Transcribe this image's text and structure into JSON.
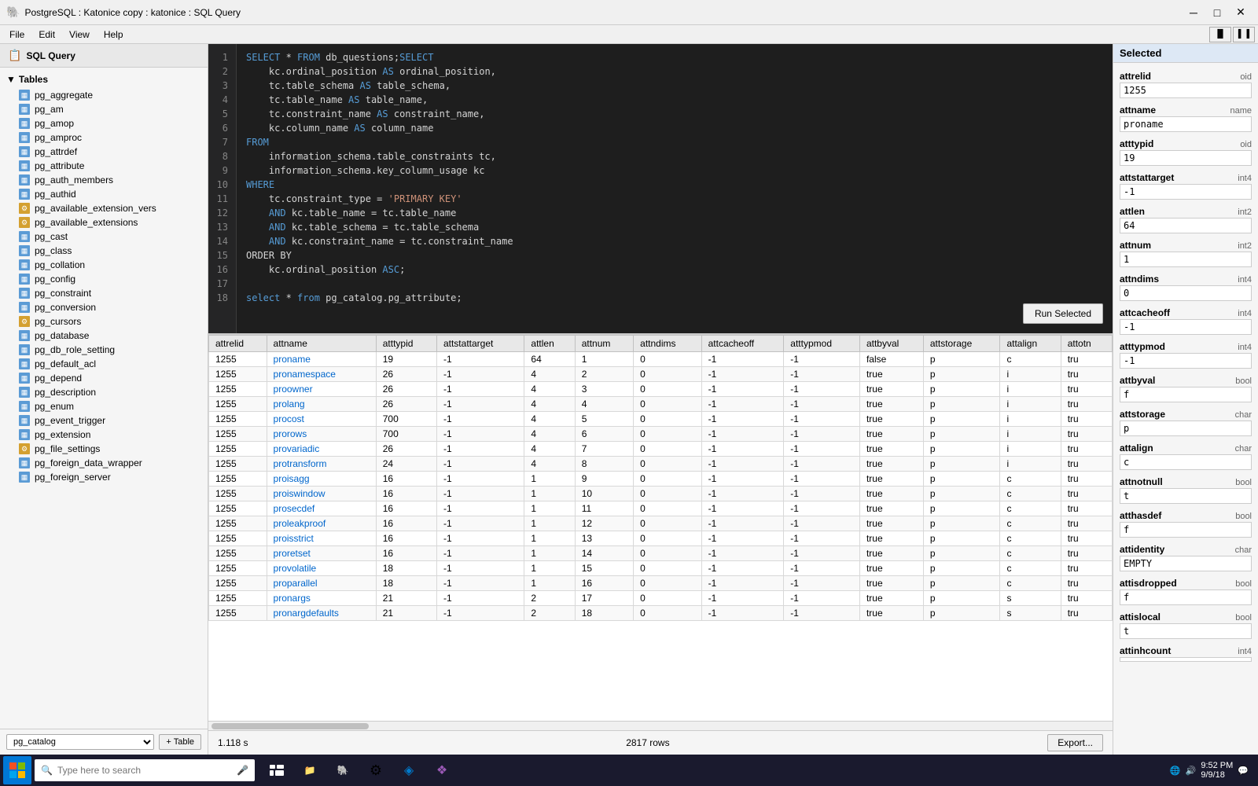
{
  "titleBar": {
    "icon": "🐘",
    "title": "PostgreSQL : Katonice copy : katonice : SQL Query",
    "minimize": "─",
    "maximize": "□",
    "close": "✕"
  },
  "menuBar": {
    "items": [
      "File",
      "Edit",
      "View",
      "Help"
    ]
  },
  "sidebar": {
    "header": "SQL Query",
    "section": "Tables",
    "tables": [
      "pg_aggregate",
      "pg_am",
      "pg_amop",
      "pg_amproc",
      "pg_attrdef",
      "pg_attribute",
      "pg_auth_members",
      "pg_authid",
      "pg_available_extension_vers",
      "pg_available_extensions",
      "pg_cast",
      "pg_class",
      "pg_collation",
      "pg_config",
      "pg_constraint",
      "pg_conversion",
      "pg_cursors",
      "pg_database",
      "pg_db_role_setting",
      "pg_default_acl",
      "pg_depend",
      "pg_description",
      "pg_enum",
      "pg_event_trigger",
      "pg_extension",
      "pg_file_settings",
      "pg_foreign_data_wrapper",
      "pg_foreign_server"
    ],
    "specialTables": [
      "pg_available_extension_vers",
      "pg_available_extensions",
      "pg_cursors",
      "pg_file_settings"
    ],
    "schema": "pg_catalog",
    "addTableLabel": "+ Table"
  },
  "editor": {
    "lines": [
      {
        "num": 1,
        "content": "SELECT * FROM db_questions;SELECT"
      },
      {
        "num": 2,
        "content": "    kc.ordinal_position AS ordinal_position,"
      },
      {
        "num": 3,
        "content": "    tc.table_schema AS table_schema,"
      },
      {
        "num": 4,
        "content": "    tc.table_name AS table_name,"
      },
      {
        "num": 5,
        "content": "    tc.constraint_name AS constraint_name,"
      },
      {
        "num": 6,
        "content": "    kc.column_name AS column_name"
      },
      {
        "num": 7,
        "content": "FROM"
      },
      {
        "num": 8,
        "content": "    information_schema.table_constraints tc,"
      },
      {
        "num": 9,
        "content": "    information_schema.key_column_usage kc"
      },
      {
        "num": 10,
        "content": "WHERE"
      },
      {
        "num": 11,
        "content": "    tc.constraint_type = 'PRIMARY KEY'"
      },
      {
        "num": 12,
        "content": "    AND kc.table_name = tc.table_name"
      },
      {
        "num": 13,
        "content": "    AND kc.table_schema = tc.table_schema"
      },
      {
        "num": 14,
        "content": "    AND kc.constraint_name = tc.constraint_name"
      },
      {
        "num": 15,
        "content": "ORDER BY"
      },
      {
        "num": 16,
        "content": "    kc.ordinal_position ASC;"
      },
      {
        "num": 17,
        "content": ""
      },
      {
        "num": 18,
        "content": "select * from pg_catalog.pg_attribute;"
      }
    ],
    "runSelectedLabel": "Run Selected"
  },
  "results": {
    "columns": [
      "attrelid",
      "attname",
      "atttypid",
      "attstattarget",
      "attlen",
      "attnum",
      "attndims",
      "attcacheoff",
      "atttypmod",
      "attbyval",
      "attstorage",
      "attalign",
      "attotn"
    ],
    "rows": [
      [
        1255,
        "proname",
        19,
        -1,
        64,
        1,
        0,
        -1,
        -1,
        "false",
        "p",
        "c",
        "tru"
      ],
      [
        1255,
        "pronamespace",
        26,
        -1,
        4,
        2,
        0,
        -1,
        -1,
        "true",
        "p",
        "i",
        "tru"
      ],
      [
        1255,
        "proowner",
        26,
        -1,
        4,
        3,
        0,
        -1,
        -1,
        "true",
        "p",
        "i",
        "tru"
      ],
      [
        1255,
        "prolang",
        26,
        -1,
        4,
        4,
        0,
        -1,
        -1,
        "true",
        "p",
        "i",
        "tru"
      ],
      [
        1255,
        "procost",
        700,
        -1,
        4,
        5,
        0,
        -1,
        -1,
        "true",
        "p",
        "i",
        "tru"
      ],
      [
        1255,
        "prorows",
        700,
        -1,
        4,
        6,
        0,
        -1,
        -1,
        "true",
        "p",
        "i",
        "tru"
      ],
      [
        1255,
        "provariadic",
        26,
        -1,
        4,
        7,
        0,
        -1,
        -1,
        "true",
        "p",
        "i",
        "tru"
      ],
      [
        1255,
        "protransform",
        24,
        -1,
        4,
        8,
        0,
        -1,
        -1,
        "true",
        "p",
        "i",
        "tru"
      ],
      [
        1255,
        "proisagg",
        16,
        -1,
        1,
        9,
        0,
        -1,
        -1,
        "true",
        "p",
        "c",
        "tru"
      ],
      [
        1255,
        "proiswindow",
        16,
        -1,
        1,
        10,
        0,
        -1,
        -1,
        "true",
        "p",
        "c",
        "tru"
      ],
      [
        1255,
        "prosecdef",
        16,
        -1,
        1,
        11,
        0,
        -1,
        -1,
        "true",
        "p",
        "c",
        "tru"
      ],
      [
        1255,
        "proleakproof",
        16,
        -1,
        1,
        12,
        0,
        -1,
        -1,
        "true",
        "p",
        "c",
        "tru"
      ],
      [
        1255,
        "proisstrict",
        16,
        -1,
        1,
        13,
        0,
        -1,
        -1,
        "true",
        "p",
        "c",
        "tru"
      ],
      [
        1255,
        "proretset",
        16,
        -1,
        1,
        14,
        0,
        -1,
        -1,
        "true",
        "p",
        "c",
        "tru"
      ],
      [
        1255,
        "provolatile",
        18,
        -1,
        1,
        15,
        0,
        -1,
        -1,
        "true",
        "p",
        "c",
        "tru"
      ],
      [
        1255,
        "proparallel",
        18,
        -1,
        1,
        16,
        0,
        -1,
        -1,
        "true",
        "p",
        "c",
        "tru"
      ],
      [
        1255,
        "pronargs",
        21,
        -1,
        2,
        17,
        0,
        -1,
        -1,
        "true",
        "p",
        "s",
        "tru"
      ],
      [
        1255,
        "pronargdefaults",
        21,
        -1,
        2,
        18,
        0,
        -1,
        -1,
        "true",
        "p",
        "s",
        "tru"
      ]
    ],
    "timing": "1.118 s",
    "rowCount": "2817 rows",
    "exportLabel": "Export..."
  },
  "rightPanel": {
    "selectedHeader": "Selected",
    "fields": [
      {
        "key": "attrelid",
        "type": "oid",
        "value": "1255"
      },
      {
        "key": "attname",
        "type": "name",
        "value": "proname"
      },
      {
        "key": "atttypid",
        "type": "oid",
        "value": "19"
      },
      {
        "key": "attstattarget",
        "type": "int4",
        "value": "-1"
      },
      {
        "key": "attlen",
        "type": "int2",
        "value": "64"
      },
      {
        "key": "attnum",
        "type": "int2",
        "value": "1"
      },
      {
        "key": "attndims",
        "type": "int4",
        "value": "0"
      },
      {
        "key": "attcacheoff",
        "type": "int4",
        "value": "-1"
      },
      {
        "key": "atttypmod",
        "type": "int4",
        "value": "-1"
      },
      {
        "key": "attbyval",
        "type": "bool",
        "value": "f"
      },
      {
        "key": "attstorage",
        "type": "char",
        "value": "p"
      },
      {
        "key": "attalign",
        "type": "char",
        "value": "c"
      },
      {
        "key": "attnotnull",
        "type": "bool",
        "value": "t"
      },
      {
        "key": "atthasdef",
        "type": "bool",
        "value": "f"
      },
      {
        "key": "attidentity",
        "type": "char",
        "value": "EMPTY"
      },
      {
        "key": "attisdropped",
        "type": "bool",
        "value": "f"
      },
      {
        "key": "attislocal",
        "type": "bool",
        "value": "t"
      },
      {
        "key": "attinhcount",
        "type": "int4",
        "value": ""
      }
    ]
  },
  "taskbar": {
    "searchPlaceholder": "Type here to search",
    "time": "9:52 PM",
    "date": "9/9/18"
  }
}
